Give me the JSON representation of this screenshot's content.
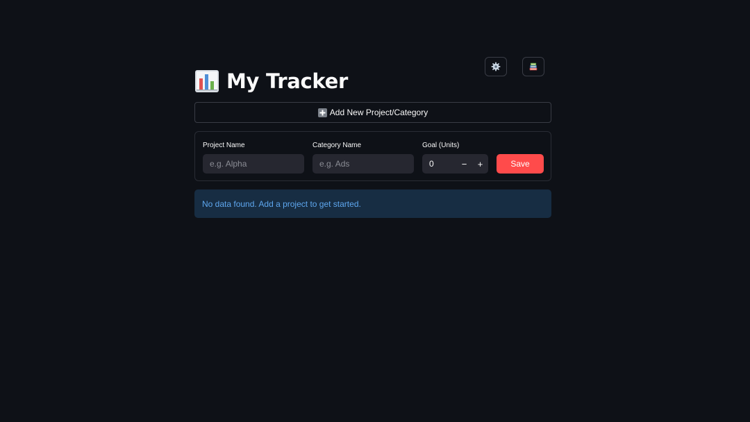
{
  "header": {
    "title": "My Tracker",
    "title_icon": "bar-chart-emoji",
    "settings_icon": "gear-icon",
    "docs_icon": "books-icon"
  },
  "add_project": {
    "label": "Add New Project/Category",
    "icon": "plus-icon"
  },
  "form": {
    "project_name_label": "Project Name",
    "project_name_placeholder": "e.g. Alpha",
    "category_name_label": "Category Name",
    "category_name_placeholder": "e.g. Ads",
    "goal_label": "Goal (Units)",
    "goal_value": "0",
    "decrement_label": "−",
    "increment_label": "+",
    "save_label": "Save"
  },
  "info": {
    "message": "No data found. Add a project to get started."
  },
  "colors": {
    "background": "#0e1117",
    "primary": "#ff4b4b",
    "input_bg": "#262730",
    "info_bg": "#172d43",
    "info_text": "#5ea7ef"
  }
}
